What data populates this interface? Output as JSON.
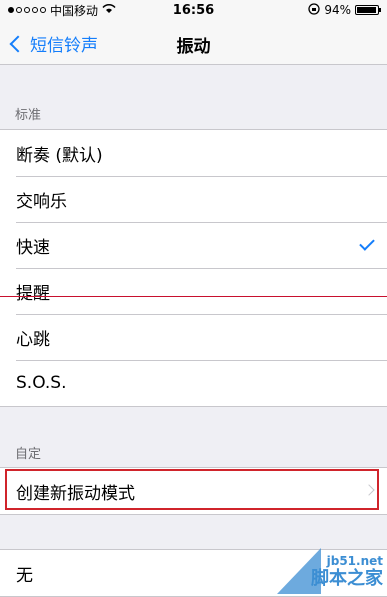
{
  "status_bar": {
    "carrier": "中国移动",
    "time": "16:56",
    "battery": "94%",
    "battery_level": 0.94
  },
  "nav": {
    "back_label": "短信铃声",
    "title": "振动"
  },
  "standard": {
    "header": "标准",
    "items": [
      {
        "label": "断奏 (默认)",
        "checked": false
      },
      {
        "label": "交响乐",
        "checked": false
      },
      {
        "label": "快速",
        "checked": true
      },
      {
        "label": "提醒",
        "checked": false
      },
      {
        "label": "心跳",
        "checked": false
      },
      {
        "label": "S.O.S.",
        "checked": false
      }
    ]
  },
  "custom": {
    "header": "自定",
    "create_label": "创建新振动模式"
  },
  "none": {
    "label": "无"
  },
  "watermark": {
    "url": "jb51.net",
    "name": "脚本之家"
  },
  "colors": {
    "accent": "#147efb",
    "annotation": "#d0242b"
  }
}
